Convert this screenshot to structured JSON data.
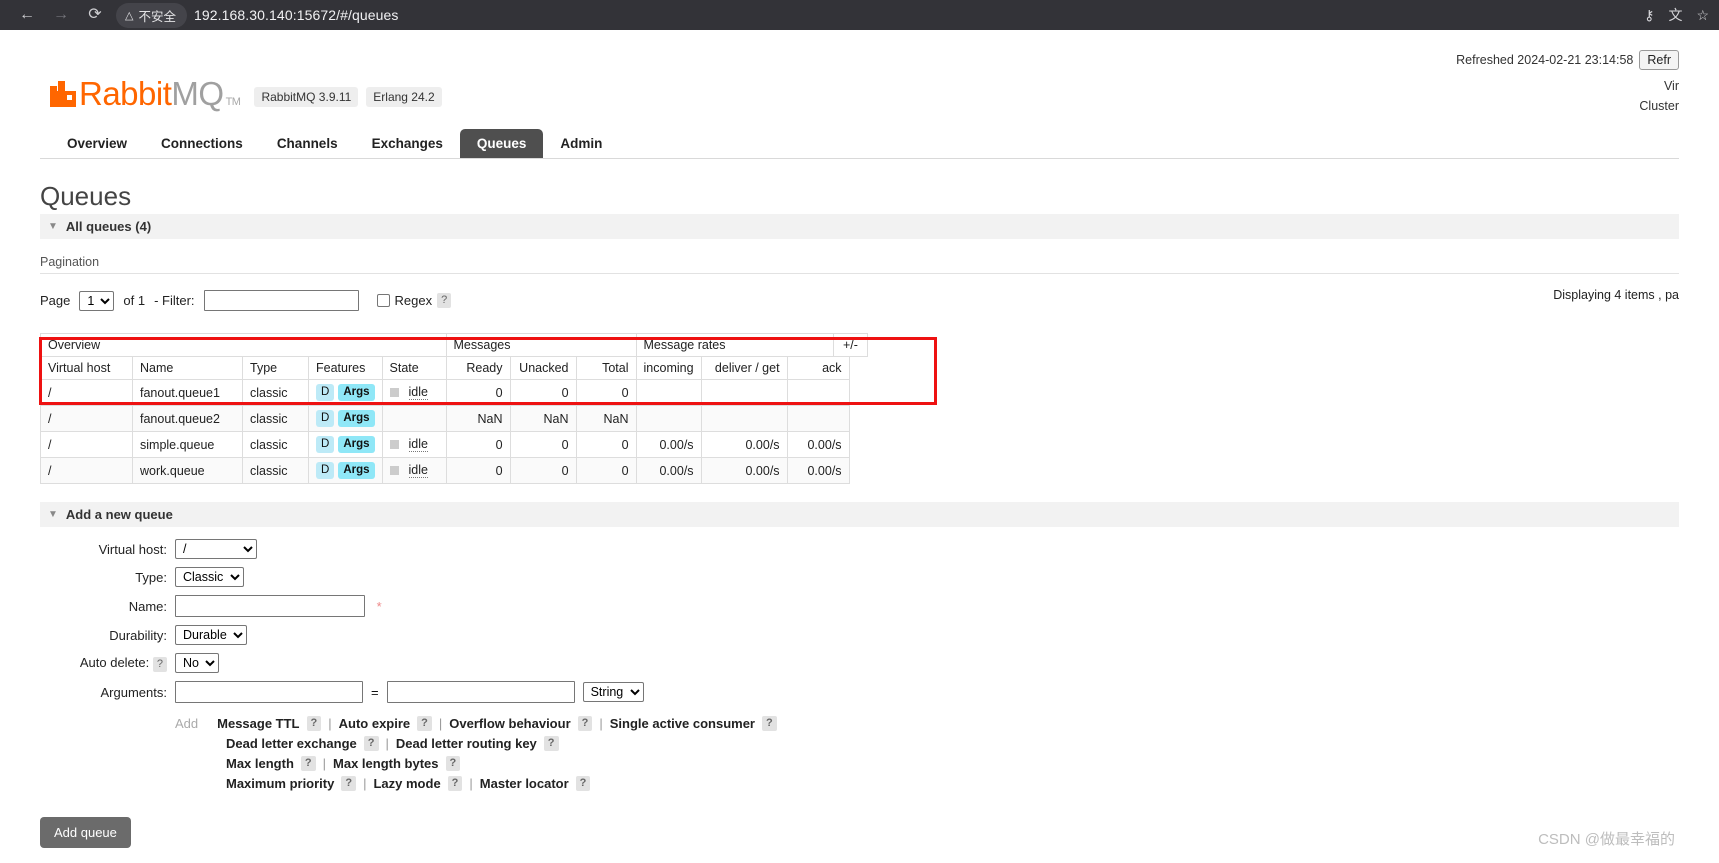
{
  "browser": {
    "back_icon": "arrow-left-icon",
    "forward_icon": "arrow-right-icon",
    "reload_icon": "reload-icon",
    "security_label": "不安全",
    "url": "192.168.30.140:15672/#/queues",
    "key_icon": "password-key-icon",
    "translate_icon": "translate-icon",
    "star_icon": "bookmark-star-icon"
  },
  "header": {
    "logo_primary": "Rabbit",
    "logo_secondary": "MQ",
    "logo_tm": "TM",
    "version_badges": [
      "RabbitMQ 3.9.11",
      "Erlang 24.2"
    ],
    "refreshed_text": "Refreshed 2024-02-21 23:14:58",
    "refresh_button": "Refr",
    "virtual_host_label": "Vir",
    "cluster_label": "Cluster"
  },
  "nav": {
    "tabs": [
      {
        "label": "Overview",
        "active": false
      },
      {
        "label": "Connections",
        "active": false
      },
      {
        "label": "Channels",
        "active": false
      },
      {
        "label": "Exchanges",
        "active": false
      },
      {
        "label": "Queues",
        "active": true
      },
      {
        "label": "Admin",
        "active": false
      }
    ]
  },
  "main": {
    "page_title": "Queues",
    "all_queues_label": "All queues (4)",
    "pagination_heading": "Pagination",
    "page_label": "Page",
    "page_value": "1",
    "of_label": "of 1",
    "filter_label": "- Filter:",
    "filter_value": "",
    "regex_label": "Regex",
    "help_mark": "?",
    "displaying_text": "Displaying 4 items , pa"
  },
  "table": {
    "group_headers": [
      "Overview",
      "Messages",
      "Message rates"
    ],
    "plus_minus": "+/-",
    "columns": [
      "Virtual host",
      "Name",
      "Type",
      "Features",
      "State",
      "Ready",
      "Unacked",
      "Total",
      "incoming",
      "deliver / get",
      "ack"
    ],
    "rows": [
      {
        "vhost": "/",
        "name": "fanout.queue1",
        "type": "classic",
        "badge_d": "D",
        "badge_args": "Args",
        "state": "idle",
        "has_state_square": true,
        "ready": "0",
        "unacked": "0",
        "total": "0",
        "incoming": "",
        "deliver_get": "",
        "ack": ""
      },
      {
        "vhost": "/",
        "name": "fanout.queue2",
        "type": "classic",
        "badge_d": "D",
        "badge_args": "Args",
        "state": "",
        "has_state_square": false,
        "ready": "NaN",
        "unacked": "NaN",
        "total": "NaN",
        "incoming": "",
        "deliver_get": "",
        "ack": ""
      },
      {
        "vhost": "/",
        "name": "simple.queue",
        "type": "classic",
        "badge_d": "D",
        "badge_args": "Args",
        "state": "idle",
        "has_state_square": true,
        "ready": "0",
        "unacked": "0",
        "total": "0",
        "incoming": "0.00/s",
        "deliver_get": "0.00/s",
        "ack": "0.00/s"
      },
      {
        "vhost": "/",
        "name": "work.queue",
        "type": "classic",
        "badge_d": "D",
        "badge_args": "Args",
        "state": "idle",
        "has_state_square": true,
        "ready": "0",
        "unacked": "0",
        "total": "0",
        "incoming": "0.00/s",
        "deliver_get": "0.00/s",
        "ack": "0.00/s"
      }
    ],
    "highlight_color": "#ee1111"
  },
  "form": {
    "section_title": "Add a new queue",
    "virtual_host_label": "Virtual host:",
    "virtual_host_value": "/",
    "type_label": "Type:",
    "type_value": "Classic",
    "name_label": "Name:",
    "name_value": "",
    "required_mark": "*",
    "durability_label": "Durability:",
    "durability_value": "Durable",
    "auto_delete_label": "Auto delete:",
    "auto_delete_value": "No",
    "arguments_label": "Arguments:",
    "argument_key": "",
    "argument_value": "",
    "equals": "=",
    "argument_type": "String",
    "add_link": "Add",
    "hints_row1": [
      "Message TTL",
      "Auto expire",
      "Overflow behaviour",
      "Single active consumer"
    ],
    "hints_row2": [
      "Dead letter exchange",
      "Dead letter routing key"
    ],
    "hints_row3": [
      "Max length",
      "Max length bytes"
    ],
    "hints_row4": [
      "Maximum priority",
      "Lazy mode",
      "Master locator"
    ],
    "submit_button": "Add queue"
  },
  "watermark": "CSDN @做最幸福的"
}
